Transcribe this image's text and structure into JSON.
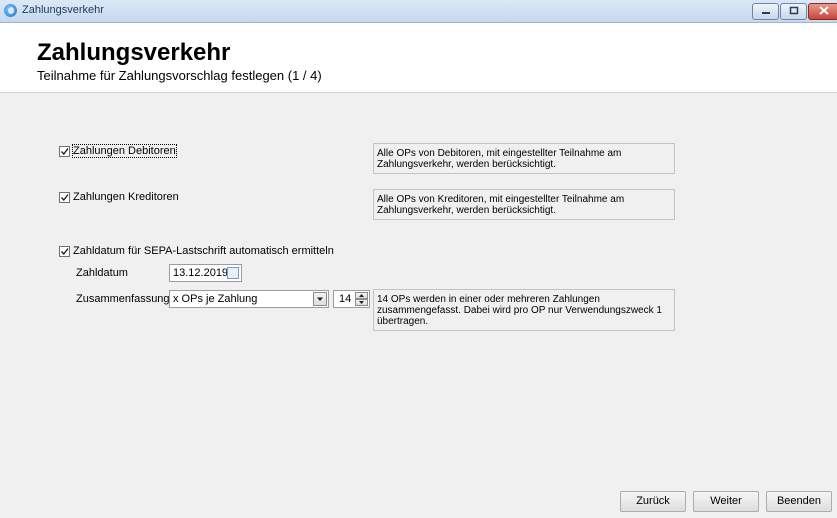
{
  "window": {
    "title": "Zahlungsverkehr"
  },
  "header": {
    "title": "Zahlungsverkehr",
    "subtitle": "Teilnahme für Zahlungsvorschlag festlegen (1 / 4)"
  },
  "options": {
    "debitoren": {
      "label": "Zahlungen Debitoren",
      "checked": true,
      "info": [
        "Alle OPs von Debitoren, mit eingestellter Teilnahme am",
        "Zahlungsverkehr, werden berücksichtigt."
      ]
    },
    "kreditoren": {
      "label": "Zahlungen Kreditoren",
      "checked": true,
      "info": [
        "Alle OPs von Kreditoren, mit eingestellter Teilnahme am",
        "Zahlungsverkehr, werden berücksichtigt."
      ]
    },
    "sepa": {
      "label": "Zahldatum für SEPA-Lastschrift automatisch ermitteln",
      "checked": true
    }
  },
  "fields": {
    "zahldatum": {
      "label": "Zahldatum",
      "value": "13.12.2019"
    },
    "zusammenfassung": {
      "label": "Zusammenfassung",
      "value": "x OPs je Zahlung",
      "count": "14",
      "info": [
        "14 OPs werden in einer oder mehreren Zahlungen",
        "zusammengefasst. Dabei wird pro OP nur Verwendungszweck 1",
        "übertragen."
      ]
    }
  },
  "buttons": {
    "back": "Zurück",
    "next": "Weiter",
    "finish": "Beenden"
  },
  "colors": {
    "titlebar": "#c7d9ee",
    "content_bg": "#f0f0f0",
    "close_button": "#c9463a"
  }
}
